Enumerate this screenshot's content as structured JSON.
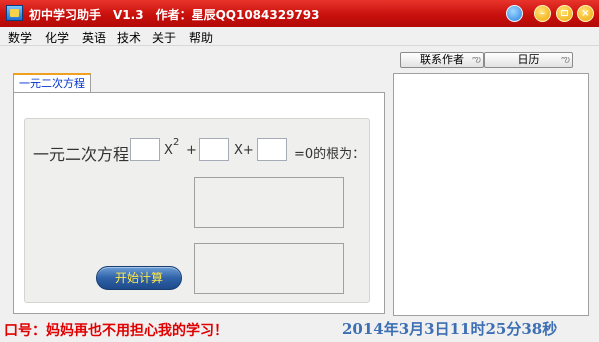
{
  "window": {
    "title_app": "初中学习助手",
    "title_version": "V1.3",
    "title_author": "作者：星辰QQ1084329793"
  },
  "menu": [
    "数学",
    "化学",
    "英语",
    "技术",
    "关于",
    "帮助"
  ],
  "tab": {
    "label": "一元二次方程"
  },
  "equation": {
    "label": "一元二次方程",
    "x2": "X",
    "exp": "2",
    "plus": "+",
    "x": "X+",
    "tail": "=0的根为：",
    "a": "",
    "b": "",
    "c": ""
  },
  "buttons": {
    "calculate": "开始计算",
    "contact": "联系作者",
    "calendar": "日历"
  },
  "status": {
    "slogan": "口号：妈妈再也不用担心我的学习！",
    "clock": "2014年3月3日11时25分38秒"
  },
  "colors": {
    "titlebar": "#c8100c",
    "slogan": "#e00000",
    "clock": "#3c6fb3",
    "button_text": "#ffe84a"
  }
}
